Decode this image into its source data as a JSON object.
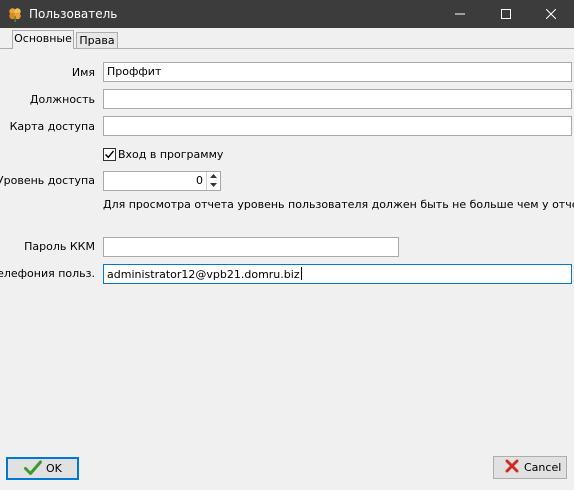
{
  "window": {
    "title": "Пользователь"
  },
  "tabs": [
    {
      "label": "Основные",
      "active": true
    },
    {
      "label": "Права",
      "active": false
    }
  ],
  "form": {
    "name_label": "Имя",
    "name_value": "Проффит",
    "position_label": "Должность",
    "position_value": "",
    "access_card_label": "Карта доступа",
    "access_card_value": "",
    "login_checkbox_label": "Вход в программу",
    "login_checked": true,
    "access_level_label": "Уровень доступа",
    "access_level_value": "0",
    "access_hint": "Для просмотра отчета уровень пользователя должен быть не больше чем у отчета",
    "kkm_password_label": "Пароль ККМ",
    "kkm_password_value": "",
    "telephony_label": "Телефония польз.",
    "telephony_value": "administrator12@vpb21.domru.biz"
  },
  "buttons": {
    "ok_label": "OK",
    "cancel_label": "Cancel"
  },
  "colors": {
    "titlebar": "#3c3c3c",
    "focus_border": "#0078d7",
    "window_bg": "#f0f0f0",
    "ok_check": "#3a9a2e",
    "cancel_x": "#d42a1f"
  },
  "icons": {
    "app": "clover-icon",
    "minimize": "minimize-icon",
    "maximize": "maximize-icon",
    "close": "close-icon",
    "ok": "check-icon",
    "cancel": "x-icon"
  }
}
